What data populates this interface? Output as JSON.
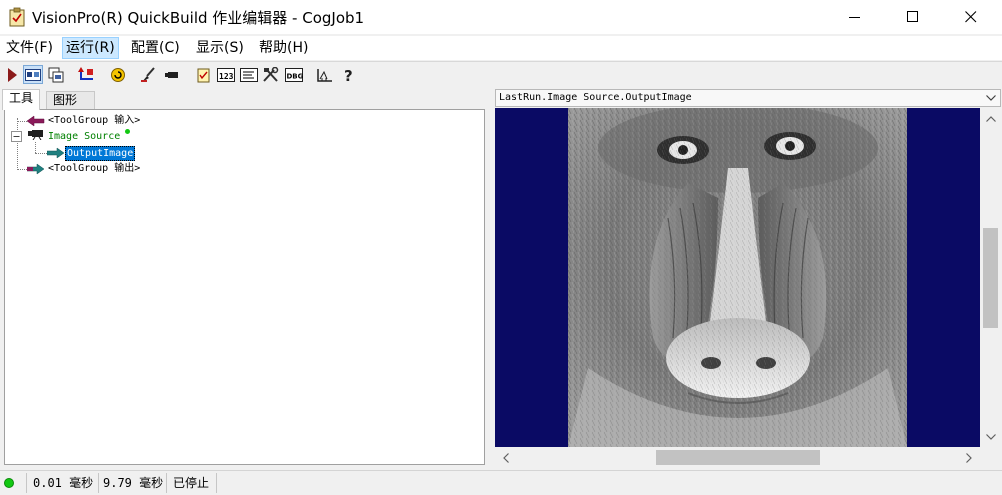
{
  "window": {
    "title": "VisionPro(R) QuickBuild 作业编辑器 - CogJob1"
  },
  "menu": [
    {
      "label": "文件(F)"
    },
    {
      "label": "运行(R)"
    },
    {
      "label": "配置(C)"
    },
    {
      "label": "显示(S)"
    },
    {
      "label": "帮助(H)"
    }
  ],
  "toolbar": {
    "items": [
      "run-icon",
      "display-toggle-icon",
      "copy-image-icon",
      "undo-icon",
      "reset-icon",
      "brush-icon",
      "camera-icon",
      "notes-icon",
      "number-icon",
      "text-icon",
      "tools-icon",
      "dbg-icon",
      "ruler-icon",
      "help-icon"
    ],
    "number_label": "123",
    "dbg_label": "DBG"
  },
  "left_tabs": [
    {
      "label": "工具"
    },
    {
      "label": "图形"
    }
  ],
  "tree": {
    "input_node": "<ToolGroup 输入>",
    "image_source_node": "Image Source",
    "output_image_node": "OutputImage",
    "output_node": "<ToolGroup 输出>",
    "expander": "⊟"
  },
  "image_view": {
    "header": "LastRun.Image Source.OutputImage"
  },
  "status": {
    "time1": "0.01 毫秒",
    "time2": "9.79 毫秒",
    "state": "已停止"
  },
  "colors": {
    "status_ok": "#12c812",
    "image_background": "#0a0a64",
    "selected_node": "#0078d7"
  }
}
